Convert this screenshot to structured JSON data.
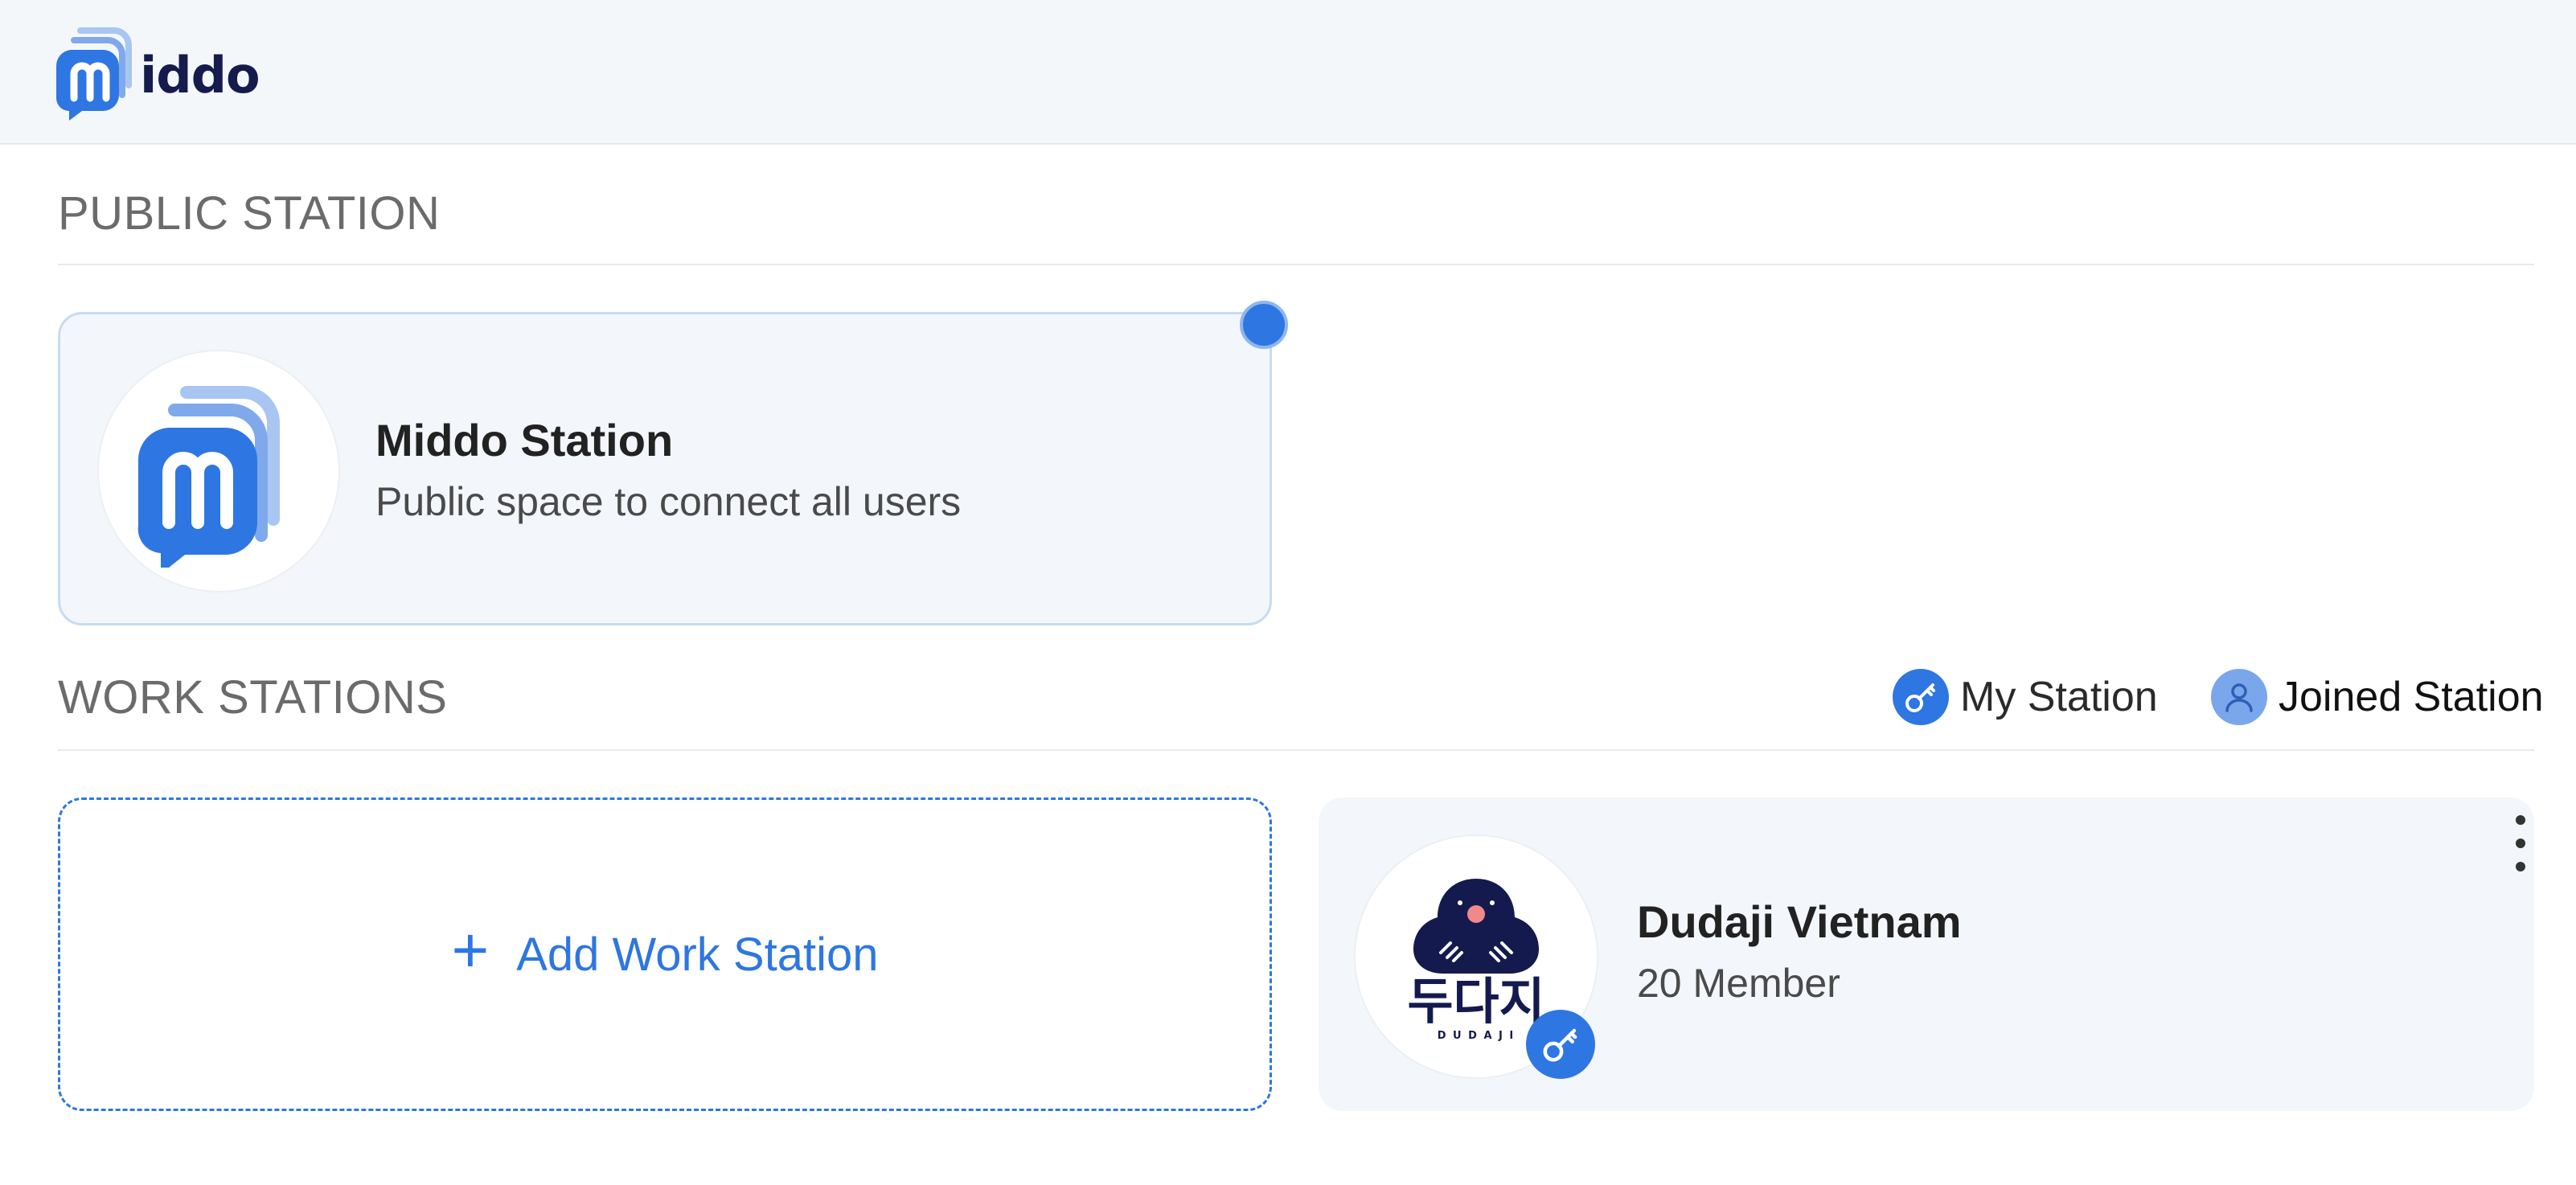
{
  "header": {
    "logo_text": "iddo"
  },
  "public_section": {
    "title": "PUBLIC STATION",
    "station": {
      "name": "Middo Station",
      "description": "Public space to connect all users"
    }
  },
  "work_section": {
    "title": "WORK STATIONS",
    "legend": {
      "my_station": "My Station",
      "joined_station": "Joined Station"
    },
    "add_label": "Add Work Station",
    "stations": [
      {
        "name": "Dudaji Vietnam",
        "members": "20 Member",
        "logo_text": "두다지",
        "logo_subtext": "D U D A J I",
        "role_icon": "key-icon"
      }
    ]
  },
  "colors": {
    "accent": "#2e76e2",
    "header_bg": "#f4f7fa",
    "card_bg": "#f3f6fa",
    "brand_dark": "#151b4d"
  }
}
